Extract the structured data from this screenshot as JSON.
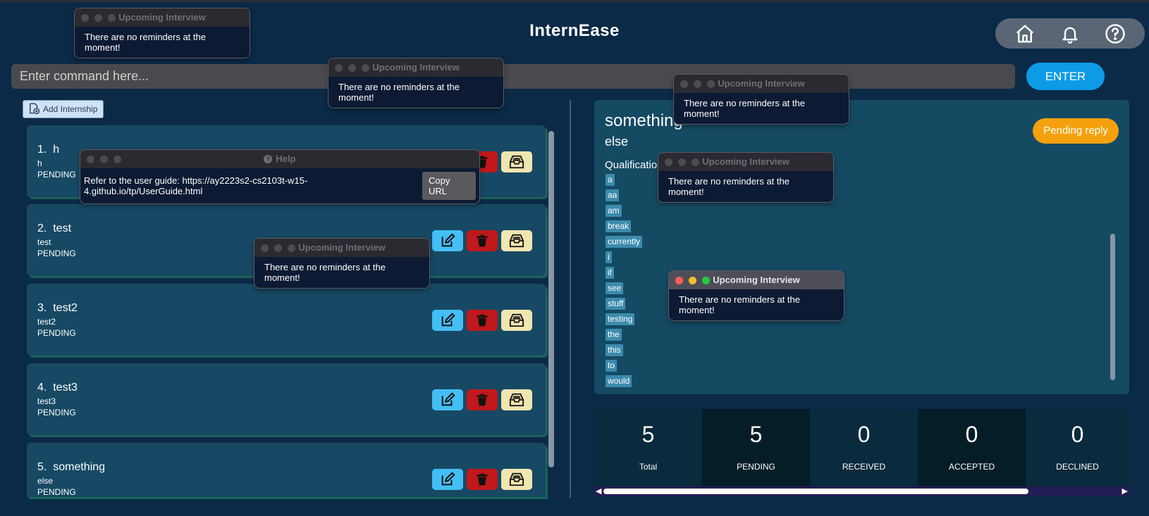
{
  "app": {
    "title": "InternEase"
  },
  "nav": {
    "icons": [
      "home-icon",
      "bell-icon",
      "help-icon"
    ]
  },
  "command": {
    "placeholder": "Enter command here...",
    "enter_label": "ENTER"
  },
  "add_button": {
    "label": "Add Internship"
  },
  "internships": [
    {
      "index": "1.",
      "title": "h",
      "subtitle": "h",
      "status": "PENDING"
    },
    {
      "index": "2.",
      "title": "test",
      "subtitle": "test",
      "status": "PENDING"
    },
    {
      "index": "3.",
      "title": "test2",
      "subtitle": "test2",
      "status": "PENDING"
    },
    {
      "index": "4.",
      "title": "test3",
      "subtitle": "test3",
      "status": "PENDING"
    },
    {
      "index": "5.",
      "title": "something",
      "subtitle": "else",
      "status": "PENDING"
    }
  ],
  "detail": {
    "title": "something",
    "subtitle": "else",
    "status_badge": "Pending reply",
    "qualifications_label": "Qualification",
    "tags": [
      "a",
      "aa",
      "am",
      "break",
      "currently",
      "i",
      "if",
      "see",
      "stuff",
      "testing",
      "the",
      "this",
      "to",
      "would"
    ]
  },
  "stats": [
    {
      "value": "5",
      "label": "Total"
    },
    {
      "value": "5",
      "label": "PENDING"
    },
    {
      "value": "0",
      "label": "RECEIVED"
    },
    {
      "value": "0",
      "label": "ACCEPTED"
    },
    {
      "value": "0",
      "label": "DECLINED"
    }
  ],
  "help_window": {
    "title": "Help",
    "text": "Refer to the user guide: https://ay2223s2-cs2103t-w15-4.github.io/tp/UserGuide.html",
    "copy_label": "Copy URL"
  },
  "reminder_windows": [
    {
      "title": "Upcoming Interview",
      "message": "There are no reminders at the moment!"
    },
    {
      "title": "Upcoming Interview",
      "message": "There are no reminders at the moment!"
    },
    {
      "title": "Upcoming Interview",
      "message": "There are no reminders at the moment!"
    },
    {
      "title": "Upcoming Interview",
      "message": "There are no reminders at the moment!"
    },
    {
      "title": "Upcoming Interview",
      "message": "There are no reminders at the moment!"
    },
    {
      "title": "Upcoming Interview",
      "message": "There are no reminders at the moment!"
    }
  ],
  "colors": {
    "background": "#0b2a47",
    "card": "#174964",
    "enter": "#0d9be6",
    "badge": "#f5a10e",
    "edit": "#43bff5",
    "delete": "#c0181b",
    "archive": "#f0e6b0",
    "tag": "#3c8bad"
  }
}
